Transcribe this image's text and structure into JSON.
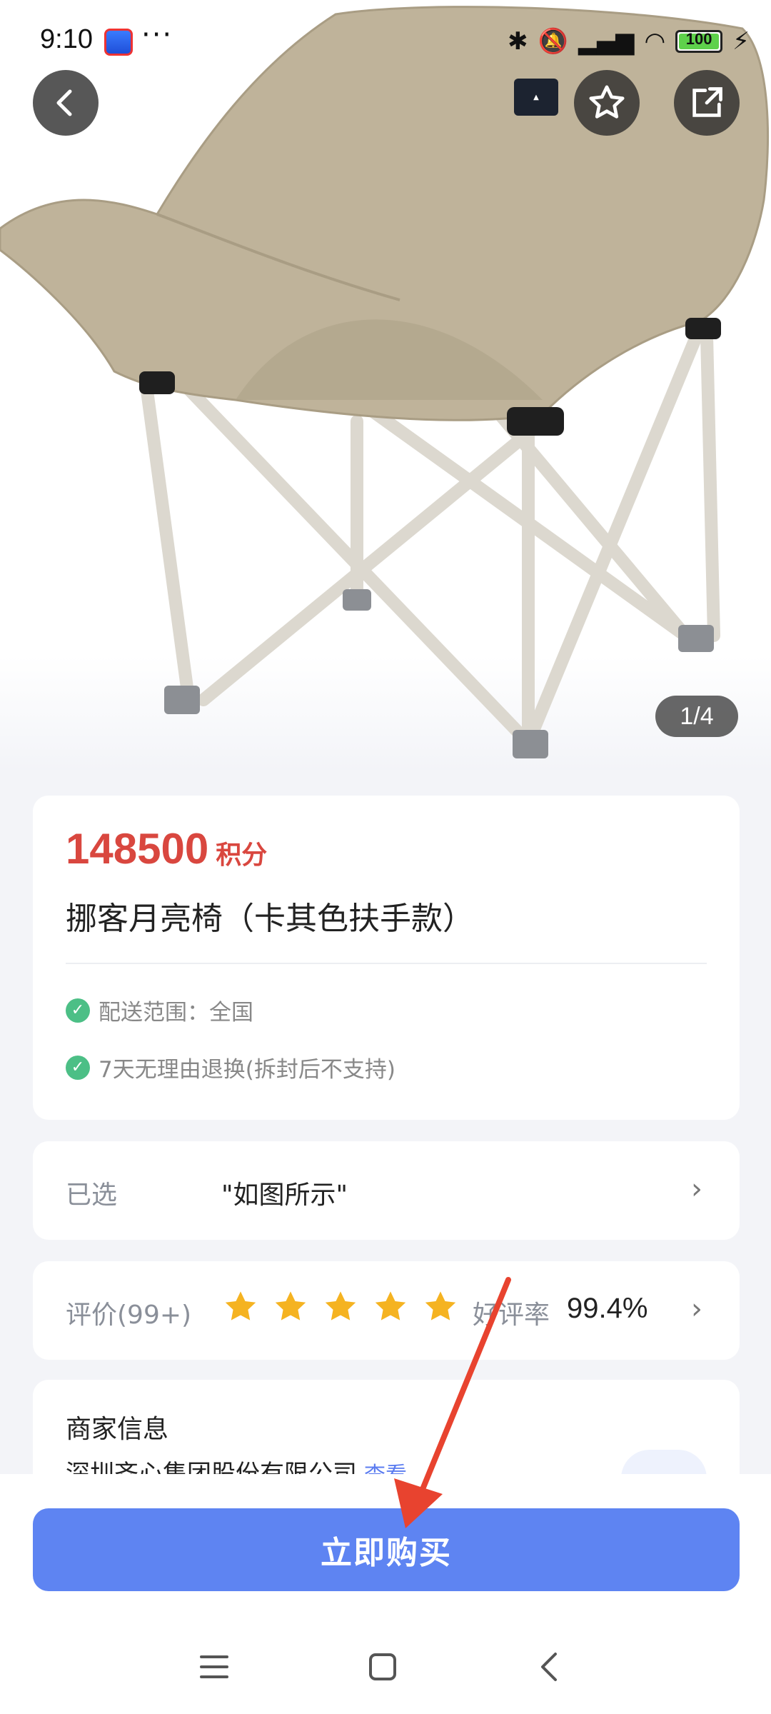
{
  "status_bar": {
    "time": "9:10",
    "more": "···",
    "battery": "100"
  },
  "hero": {
    "pager": "1/4",
    "back_icon": "chevron-left-icon",
    "favorite_icon": "star-outline-icon",
    "share_icon": "share-icon"
  },
  "product": {
    "price": "148500",
    "price_unit": "积分",
    "title": "挪客月亮椅（卡其色扶手款）",
    "features": [
      "配送范围：全国",
      "7天无理由退换(拆封后不支持)"
    ]
  },
  "selection": {
    "label": "已选",
    "value": "\"如图所示\""
  },
  "reviews": {
    "label": "评价(99+)",
    "stars": 5,
    "rate_label": "好评率",
    "rate_value": "99.4%"
  },
  "merchant": {
    "title": "商家信息",
    "name": "深圳齐心集团股份有限公司",
    "link": "查看"
  },
  "actions": {
    "buy": "立即购买"
  },
  "colors": {
    "price": "#d9473f",
    "buy_button": "#5e84f2",
    "check": "#4cbf86",
    "star": "#f5b321",
    "arrow": "#e8432f"
  }
}
